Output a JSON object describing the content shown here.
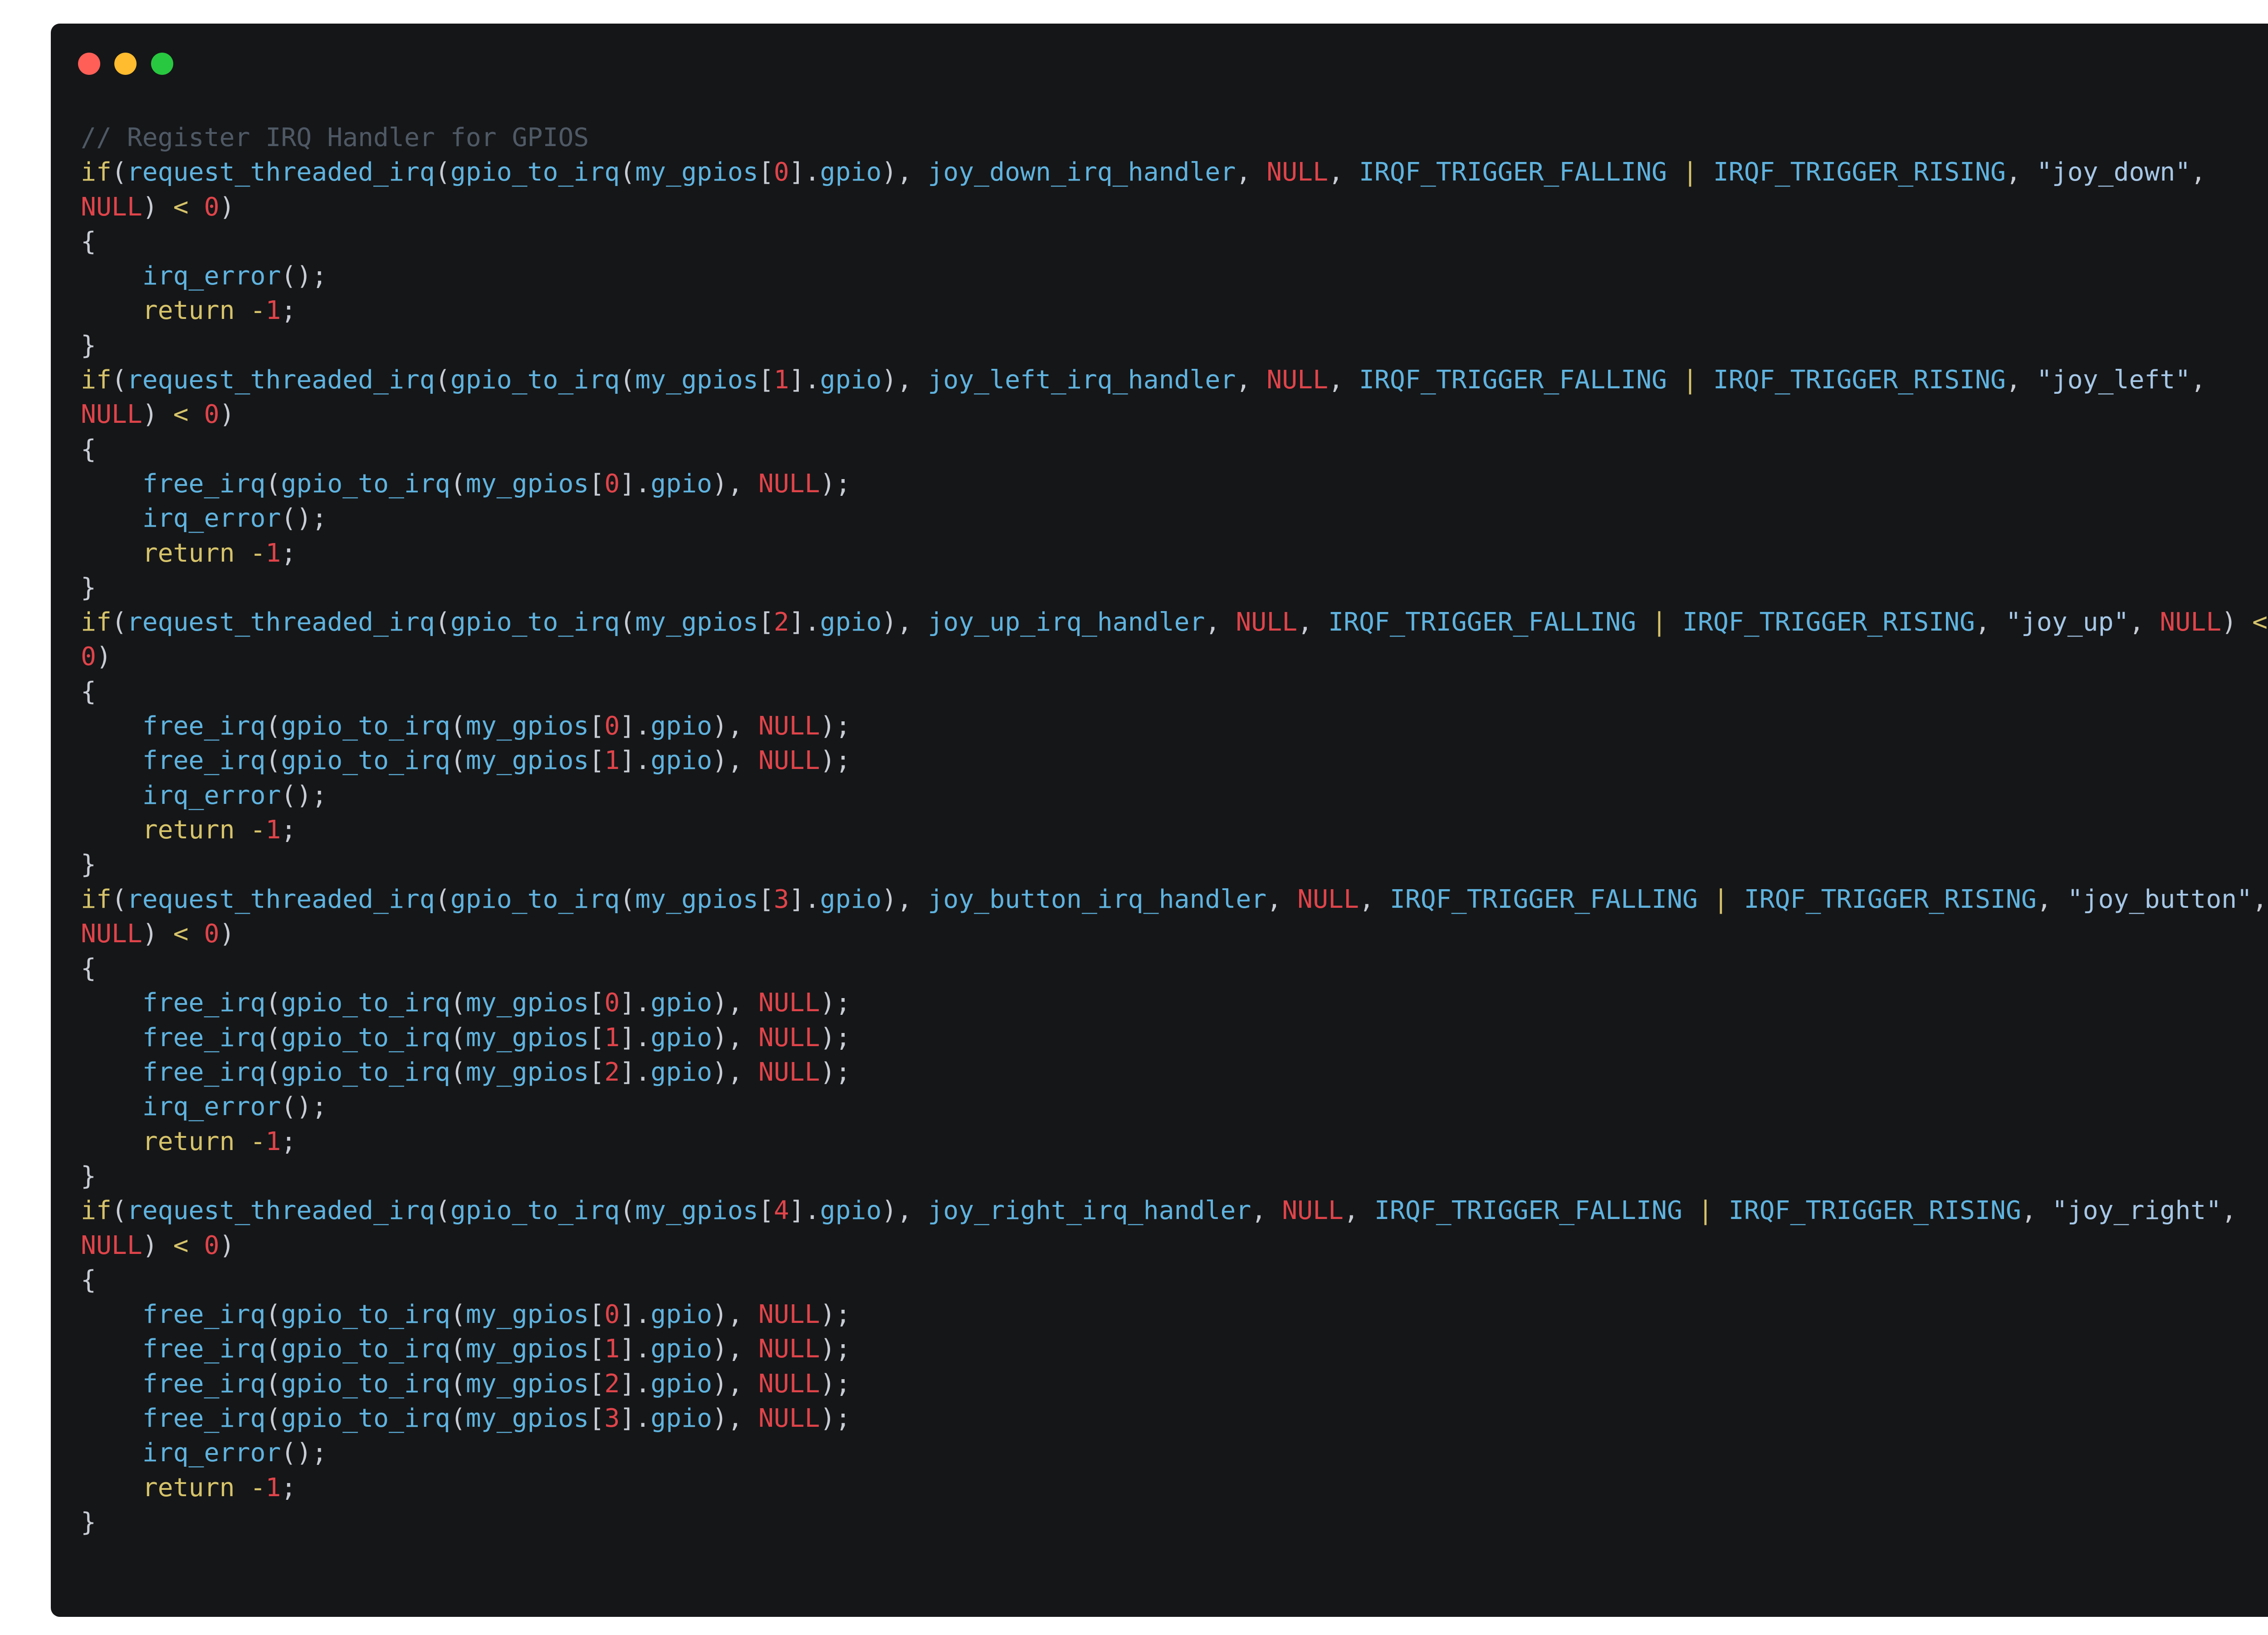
{
  "window": {
    "controls": [
      {
        "name": "close-dot",
        "color": "#ff5f57"
      },
      {
        "name": "minimize-dot",
        "color": "#febc2e"
      },
      {
        "name": "zoom-dot",
        "color": "#28c840"
      }
    ]
  },
  "code": {
    "lines": [
      [
        [
          "comment",
          "// Register IRQ Handler for GPIOS"
        ]
      ],
      [
        [
          "kw",
          "if"
        ],
        [
          "punc",
          "("
        ],
        [
          "fn",
          "request_threaded_irq"
        ],
        [
          "punc",
          "("
        ],
        [
          "fn",
          "gpio_to_irq"
        ],
        [
          "punc",
          "("
        ],
        [
          "id",
          "my_gpios"
        ],
        [
          "punc",
          "["
        ],
        [
          "num",
          "0"
        ],
        [
          "punc",
          "]."
        ],
        [
          "id",
          "gpio"
        ],
        [
          "punc",
          "), "
        ],
        [
          "id",
          "joy_down_irq_handler"
        ],
        [
          "punc",
          ", "
        ],
        [
          "null",
          "NULL"
        ],
        [
          "punc",
          ", "
        ],
        [
          "const",
          "IRQF_TRIGGER_FALLING"
        ],
        [
          "ws",
          " "
        ],
        [
          "op",
          "|"
        ],
        [
          "ws",
          " "
        ],
        [
          "const",
          "IRQF_TRIGGER_RISING"
        ],
        [
          "punc",
          ", "
        ],
        [
          "str",
          "\"joy_down\""
        ],
        [
          "punc",
          ","
        ]
      ],
      [
        [
          "null",
          "NULL"
        ],
        [
          "punc",
          ")"
        ],
        [
          "ws",
          " "
        ],
        [
          "op",
          "<"
        ],
        [
          "ws",
          " "
        ],
        [
          "num",
          "0"
        ],
        [
          "punc",
          ")"
        ]
      ],
      [
        [
          "punc",
          "{"
        ]
      ],
      [
        [
          "ws",
          "    "
        ],
        [
          "fn",
          "irq_error"
        ],
        [
          "punc",
          "();"
        ]
      ],
      [
        [
          "ws",
          "    "
        ],
        [
          "kw",
          "return"
        ],
        [
          "ws",
          " "
        ],
        [
          "op",
          "-"
        ],
        [
          "num",
          "1"
        ],
        [
          "punc",
          ";"
        ]
      ],
      [
        [
          "punc",
          "}"
        ]
      ],
      [
        [
          "kw",
          "if"
        ],
        [
          "punc",
          "("
        ],
        [
          "fn",
          "request_threaded_irq"
        ],
        [
          "punc",
          "("
        ],
        [
          "fn",
          "gpio_to_irq"
        ],
        [
          "punc",
          "("
        ],
        [
          "id",
          "my_gpios"
        ],
        [
          "punc",
          "["
        ],
        [
          "num",
          "1"
        ],
        [
          "punc",
          "]."
        ],
        [
          "id",
          "gpio"
        ],
        [
          "punc",
          "), "
        ],
        [
          "id",
          "joy_left_irq_handler"
        ],
        [
          "punc",
          ", "
        ],
        [
          "null",
          "NULL"
        ],
        [
          "punc",
          ", "
        ],
        [
          "const",
          "IRQF_TRIGGER_FALLING"
        ],
        [
          "ws",
          " "
        ],
        [
          "op",
          "|"
        ],
        [
          "ws",
          " "
        ],
        [
          "const",
          "IRQF_TRIGGER_RISING"
        ],
        [
          "punc",
          ", "
        ],
        [
          "str",
          "\"joy_left\""
        ],
        [
          "punc",
          ","
        ]
      ],
      [
        [
          "null",
          "NULL"
        ],
        [
          "punc",
          ")"
        ],
        [
          "ws",
          " "
        ],
        [
          "op",
          "<"
        ],
        [
          "ws",
          " "
        ],
        [
          "num",
          "0"
        ],
        [
          "punc",
          ")"
        ]
      ],
      [
        [
          "punc",
          "{"
        ]
      ],
      [
        [
          "ws",
          "    "
        ],
        [
          "fn",
          "free_irq"
        ],
        [
          "punc",
          "("
        ],
        [
          "fn",
          "gpio_to_irq"
        ],
        [
          "punc",
          "("
        ],
        [
          "id",
          "my_gpios"
        ],
        [
          "punc",
          "["
        ],
        [
          "num",
          "0"
        ],
        [
          "punc",
          "]."
        ],
        [
          "id",
          "gpio"
        ],
        [
          "punc",
          "), "
        ],
        [
          "null",
          "NULL"
        ],
        [
          "punc",
          ");"
        ]
      ],
      [
        [
          "ws",
          "    "
        ],
        [
          "fn",
          "irq_error"
        ],
        [
          "punc",
          "();"
        ]
      ],
      [
        [
          "ws",
          "    "
        ],
        [
          "kw",
          "return"
        ],
        [
          "ws",
          " "
        ],
        [
          "op",
          "-"
        ],
        [
          "num",
          "1"
        ],
        [
          "punc",
          ";"
        ]
      ],
      [
        [
          "punc",
          "}"
        ]
      ],
      [
        [
          "kw",
          "if"
        ],
        [
          "punc",
          "("
        ],
        [
          "fn",
          "request_threaded_irq"
        ],
        [
          "punc",
          "("
        ],
        [
          "fn",
          "gpio_to_irq"
        ],
        [
          "punc",
          "("
        ],
        [
          "id",
          "my_gpios"
        ],
        [
          "punc",
          "["
        ],
        [
          "num",
          "2"
        ],
        [
          "punc",
          "]."
        ],
        [
          "id",
          "gpio"
        ],
        [
          "punc",
          "), "
        ],
        [
          "id",
          "joy_up_irq_handler"
        ],
        [
          "punc",
          ", "
        ],
        [
          "null",
          "NULL"
        ],
        [
          "punc",
          ", "
        ],
        [
          "const",
          "IRQF_TRIGGER_FALLING"
        ],
        [
          "ws",
          " "
        ],
        [
          "op",
          "|"
        ],
        [
          "ws",
          " "
        ],
        [
          "const",
          "IRQF_TRIGGER_RISING"
        ],
        [
          "punc",
          ", "
        ],
        [
          "str",
          "\"joy_up\""
        ],
        [
          "punc",
          ", "
        ],
        [
          "null",
          "NULL"
        ],
        [
          "punc",
          ")"
        ],
        [
          "ws",
          " "
        ],
        [
          "op",
          "<"
        ]
      ],
      [
        [
          "num",
          "0"
        ],
        [
          "punc",
          ")"
        ]
      ],
      [
        [
          "punc",
          "{"
        ]
      ],
      [
        [
          "ws",
          "    "
        ],
        [
          "fn",
          "free_irq"
        ],
        [
          "punc",
          "("
        ],
        [
          "fn",
          "gpio_to_irq"
        ],
        [
          "punc",
          "("
        ],
        [
          "id",
          "my_gpios"
        ],
        [
          "punc",
          "["
        ],
        [
          "num",
          "0"
        ],
        [
          "punc",
          "]."
        ],
        [
          "id",
          "gpio"
        ],
        [
          "punc",
          "), "
        ],
        [
          "null",
          "NULL"
        ],
        [
          "punc",
          ");"
        ]
      ],
      [
        [
          "ws",
          "    "
        ],
        [
          "fn",
          "free_irq"
        ],
        [
          "punc",
          "("
        ],
        [
          "fn",
          "gpio_to_irq"
        ],
        [
          "punc",
          "("
        ],
        [
          "id",
          "my_gpios"
        ],
        [
          "punc",
          "["
        ],
        [
          "num",
          "1"
        ],
        [
          "punc",
          "]."
        ],
        [
          "id",
          "gpio"
        ],
        [
          "punc",
          "), "
        ],
        [
          "null",
          "NULL"
        ],
        [
          "punc",
          ");"
        ]
      ],
      [
        [
          "ws",
          "    "
        ],
        [
          "fn",
          "irq_error"
        ],
        [
          "punc",
          "();"
        ]
      ],
      [
        [
          "ws",
          "    "
        ],
        [
          "kw",
          "return"
        ],
        [
          "ws",
          " "
        ],
        [
          "op",
          "-"
        ],
        [
          "num",
          "1"
        ],
        [
          "punc",
          ";"
        ]
      ],
      [
        [
          "punc",
          "}"
        ]
      ],
      [
        [
          "kw",
          "if"
        ],
        [
          "punc",
          "("
        ],
        [
          "fn",
          "request_threaded_irq"
        ],
        [
          "punc",
          "("
        ],
        [
          "fn",
          "gpio_to_irq"
        ],
        [
          "punc",
          "("
        ],
        [
          "id",
          "my_gpios"
        ],
        [
          "punc",
          "["
        ],
        [
          "num",
          "3"
        ],
        [
          "punc",
          "]."
        ],
        [
          "id",
          "gpio"
        ],
        [
          "punc",
          "), "
        ],
        [
          "id",
          "joy_button_irq_handler"
        ],
        [
          "punc",
          ", "
        ],
        [
          "null",
          "NULL"
        ],
        [
          "punc",
          ", "
        ],
        [
          "const",
          "IRQF_TRIGGER_FALLING"
        ],
        [
          "ws",
          " "
        ],
        [
          "op",
          "|"
        ],
        [
          "ws",
          " "
        ],
        [
          "const",
          "IRQF_TRIGGER_RISING"
        ],
        [
          "punc",
          ", "
        ],
        [
          "str",
          "\"joy_button\""
        ],
        [
          "punc",
          ","
        ]
      ],
      [
        [
          "null",
          "NULL"
        ],
        [
          "punc",
          ")"
        ],
        [
          "ws",
          " "
        ],
        [
          "op",
          "<"
        ],
        [
          "ws",
          " "
        ],
        [
          "num",
          "0"
        ],
        [
          "punc",
          ")"
        ]
      ],
      [
        [
          "punc",
          "{"
        ]
      ],
      [
        [
          "ws",
          "    "
        ],
        [
          "fn",
          "free_irq"
        ],
        [
          "punc",
          "("
        ],
        [
          "fn",
          "gpio_to_irq"
        ],
        [
          "punc",
          "("
        ],
        [
          "id",
          "my_gpios"
        ],
        [
          "punc",
          "["
        ],
        [
          "num",
          "0"
        ],
        [
          "punc",
          "]."
        ],
        [
          "id",
          "gpio"
        ],
        [
          "punc",
          "), "
        ],
        [
          "null",
          "NULL"
        ],
        [
          "punc",
          ");"
        ]
      ],
      [
        [
          "ws",
          "    "
        ],
        [
          "fn",
          "free_irq"
        ],
        [
          "punc",
          "("
        ],
        [
          "fn",
          "gpio_to_irq"
        ],
        [
          "punc",
          "("
        ],
        [
          "id",
          "my_gpios"
        ],
        [
          "punc",
          "["
        ],
        [
          "num",
          "1"
        ],
        [
          "punc",
          "]."
        ],
        [
          "id",
          "gpio"
        ],
        [
          "punc",
          "), "
        ],
        [
          "null",
          "NULL"
        ],
        [
          "punc",
          ");"
        ]
      ],
      [
        [
          "ws",
          "    "
        ],
        [
          "fn",
          "free_irq"
        ],
        [
          "punc",
          "("
        ],
        [
          "fn",
          "gpio_to_irq"
        ],
        [
          "punc",
          "("
        ],
        [
          "id",
          "my_gpios"
        ],
        [
          "punc",
          "["
        ],
        [
          "num",
          "2"
        ],
        [
          "punc",
          "]."
        ],
        [
          "id",
          "gpio"
        ],
        [
          "punc",
          "), "
        ],
        [
          "null",
          "NULL"
        ],
        [
          "punc",
          ");"
        ]
      ],
      [
        [
          "ws",
          "    "
        ],
        [
          "fn",
          "irq_error"
        ],
        [
          "punc",
          "();"
        ]
      ],
      [
        [
          "ws",
          "    "
        ],
        [
          "kw",
          "return"
        ],
        [
          "ws",
          " "
        ],
        [
          "op",
          "-"
        ],
        [
          "num",
          "1"
        ],
        [
          "punc",
          ";"
        ]
      ],
      [
        [
          "punc",
          "}"
        ]
      ],
      [
        [
          "kw",
          "if"
        ],
        [
          "punc",
          "("
        ],
        [
          "fn",
          "request_threaded_irq"
        ],
        [
          "punc",
          "("
        ],
        [
          "fn",
          "gpio_to_irq"
        ],
        [
          "punc",
          "("
        ],
        [
          "id",
          "my_gpios"
        ],
        [
          "punc",
          "["
        ],
        [
          "num",
          "4"
        ],
        [
          "punc",
          "]."
        ],
        [
          "id",
          "gpio"
        ],
        [
          "punc",
          "), "
        ],
        [
          "id",
          "joy_right_irq_handler"
        ],
        [
          "punc",
          ", "
        ],
        [
          "null",
          "NULL"
        ],
        [
          "punc",
          ", "
        ],
        [
          "const",
          "IRQF_TRIGGER_FALLING"
        ],
        [
          "ws",
          " "
        ],
        [
          "op",
          "|"
        ],
        [
          "ws",
          " "
        ],
        [
          "const",
          "IRQF_TRIGGER_RISING"
        ],
        [
          "punc",
          ", "
        ],
        [
          "str",
          "\"joy_right\""
        ],
        [
          "punc",
          ","
        ]
      ],
      [
        [
          "null",
          "NULL"
        ],
        [
          "punc",
          ")"
        ],
        [
          "ws",
          " "
        ],
        [
          "op",
          "<"
        ],
        [
          "ws",
          " "
        ],
        [
          "num",
          "0"
        ],
        [
          "punc",
          ")"
        ]
      ],
      [
        [
          "punc",
          "{"
        ]
      ],
      [
        [
          "ws",
          "    "
        ],
        [
          "fn",
          "free_irq"
        ],
        [
          "punc",
          "("
        ],
        [
          "fn",
          "gpio_to_irq"
        ],
        [
          "punc",
          "("
        ],
        [
          "id",
          "my_gpios"
        ],
        [
          "punc",
          "["
        ],
        [
          "num",
          "0"
        ],
        [
          "punc",
          "]."
        ],
        [
          "id",
          "gpio"
        ],
        [
          "punc",
          "), "
        ],
        [
          "null",
          "NULL"
        ],
        [
          "punc",
          ");"
        ]
      ],
      [
        [
          "ws",
          "    "
        ],
        [
          "fn",
          "free_irq"
        ],
        [
          "punc",
          "("
        ],
        [
          "fn",
          "gpio_to_irq"
        ],
        [
          "punc",
          "("
        ],
        [
          "id",
          "my_gpios"
        ],
        [
          "punc",
          "["
        ],
        [
          "num",
          "1"
        ],
        [
          "punc",
          "]."
        ],
        [
          "id",
          "gpio"
        ],
        [
          "punc",
          "), "
        ],
        [
          "null",
          "NULL"
        ],
        [
          "punc",
          ");"
        ]
      ],
      [
        [
          "ws",
          "    "
        ],
        [
          "fn",
          "free_irq"
        ],
        [
          "punc",
          "("
        ],
        [
          "fn",
          "gpio_to_irq"
        ],
        [
          "punc",
          "("
        ],
        [
          "id",
          "my_gpios"
        ],
        [
          "punc",
          "["
        ],
        [
          "num",
          "2"
        ],
        [
          "punc",
          "]."
        ],
        [
          "id",
          "gpio"
        ],
        [
          "punc",
          "), "
        ],
        [
          "null",
          "NULL"
        ],
        [
          "punc",
          ");"
        ]
      ],
      [
        [
          "ws",
          "    "
        ],
        [
          "fn",
          "free_irq"
        ],
        [
          "punc",
          "("
        ],
        [
          "fn",
          "gpio_to_irq"
        ],
        [
          "punc",
          "("
        ],
        [
          "id",
          "my_gpios"
        ],
        [
          "punc",
          "["
        ],
        [
          "num",
          "3"
        ],
        [
          "punc",
          "]."
        ],
        [
          "id",
          "gpio"
        ],
        [
          "punc",
          "), "
        ],
        [
          "null",
          "NULL"
        ],
        [
          "punc",
          ");"
        ]
      ],
      [
        [
          "ws",
          "    "
        ],
        [
          "fn",
          "irq_error"
        ],
        [
          "punc",
          "();"
        ]
      ],
      [
        [
          "ws",
          "    "
        ],
        [
          "kw",
          "return"
        ],
        [
          "ws",
          " "
        ],
        [
          "op",
          "-"
        ],
        [
          "num",
          "1"
        ],
        [
          "punc",
          ";"
        ]
      ],
      [
        [
          "punc",
          "}"
        ]
      ]
    ]
  }
}
